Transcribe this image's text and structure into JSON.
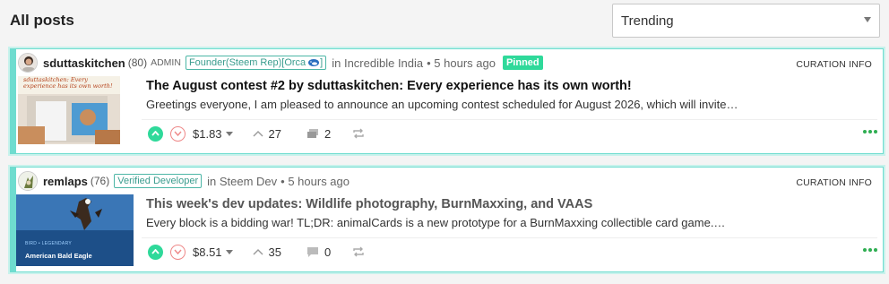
{
  "page": {
    "title": "All posts",
    "sort": {
      "selected": "Trending"
    }
  },
  "posts": [
    {
      "author": "sduttaskitchen",
      "rep": "(80)",
      "role": "ADMIN",
      "badge": "Founder(Steem Rep)[Orca",
      "badge_suffix": "]",
      "community_in": "in",
      "community": "Incredible India",
      "time": "• 5 hours ago",
      "pinned": "Pinned",
      "curation": "CURATION INFO",
      "thumb_text": "sduttaskitchen: Every experience has its own worth!",
      "title": "The August contest #2 by sduttaskitchen: Every experience has its own worth!",
      "excerpt": "Greetings everyone, I am pleased to announce an upcoming contest scheduled for August 2026, which will invite…",
      "payout": "$1.83",
      "votes": "27",
      "comments": "2"
    },
    {
      "author": "remlaps",
      "rep": "(76)",
      "badge": "Verified Developer",
      "community_in": "in",
      "community": "Steem Dev",
      "time": "• 5 hours ago",
      "curation": "CURATION INFO",
      "thumb_text_small": "BIRD • LEGENDARY",
      "thumb_text": "American Bald Eagle",
      "title": "This week's dev updates: Wildlife photography, BurnMaxxing, and VAAS",
      "excerpt": "Every block is a bidding war! TL;DR: animalCards is a new prototype for a BurnMaxxing collectible card game.…",
      "payout": "$8.51",
      "votes": "35",
      "comments": "0"
    }
  ],
  "colors": {
    "accent": "#2fd99a",
    "border": "#6fdccf",
    "downvote": "#e88888",
    "more": "#2fae52"
  }
}
